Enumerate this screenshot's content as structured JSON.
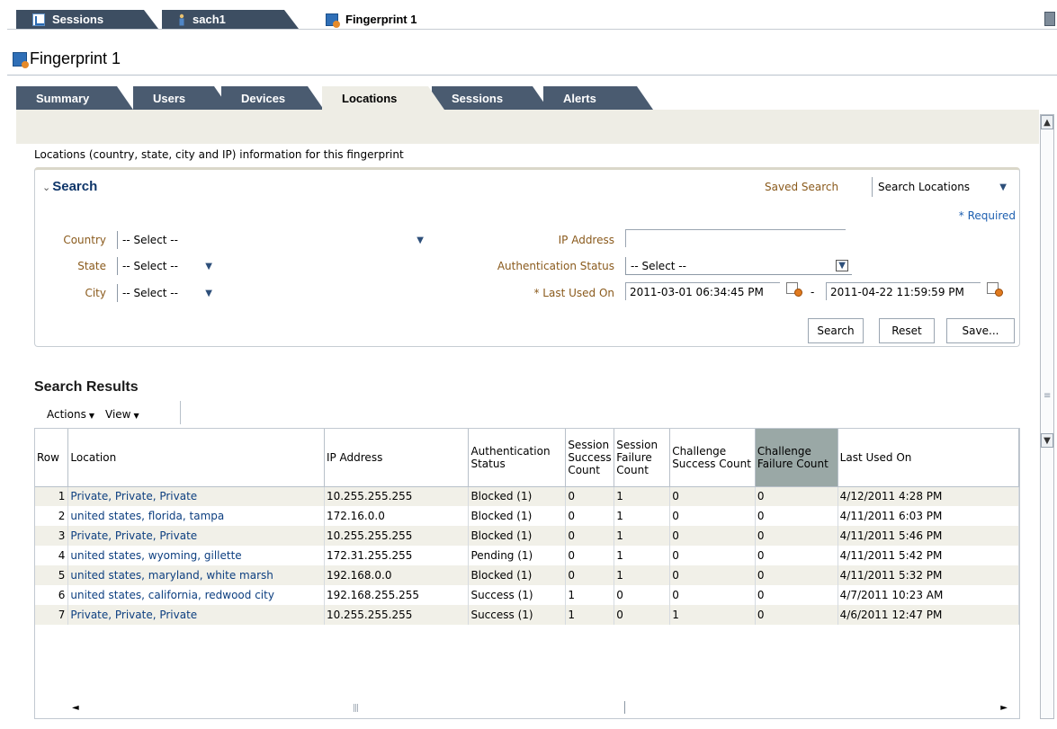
{
  "window_tabs": [
    {
      "label": "Sessions",
      "icon": "sessions-icon"
    },
    {
      "label": "sach1",
      "icon": "user-icon"
    },
    {
      "label": "Fingerprint 1",
      "icon": "fingerprint-icon"
    }
  ],
  "page": {
    "title": "Fingerprint 1"
  },
  "tabs": [
    {
      "label": "Summary"
    },
    {
      "label": "Users"
    },
    {
      "label": "Devices"
    },
    {
      "label": "Locations",
      "active": true
    },
    {
      "label": "Sessions"
    },
    {
      "label": "Alerts"
    }
  ],
  "description": "Locations (country, state, city and IP) information for this fingerprint",
  "search": {
    "header": "Search",
    "saved_search_label": "Saved Search",
    "saved_search_value": "Search Locations",
    "required_note": "* Required",
    "country_label": "Country",
    "country_value": "-- Select --",
    "state_label": "State",
    "state_value": "-- Select --",
    "city_label": "City",
    "city_value": "-- Select --",
    "ip_label": "IP Address",
    "ip_value": "",
    "auth_label": "Authentication Status",
    "auth_value": "-- Select --",
    "last_used_label": "* Last Used On",
    "date_from": "2011-03-01 06:34:45 PM",
    "date_sep": "-",
    "date_to": "2011-04-22 11:59:59 PM",
    "buttons": {
      "search": "Search",
      "reset": "Reset",
      "save": "Save..."
    }
  },
  "results": {
    "title": "Search Results",
    "actions_label": "Actions",
    "view_label": "View",
    "columns": [
      "Row",
      "Location",
      "IP Address",
      "Authentication Status",
      "Session Success Count",
      "Session Failure Count",
      "Challenge Success Count",
      "Challenge Failure Count",
      "Last Used On"
    ],
    "rows": [
      [
        "1",
        "Private, Private, Private",
        "10.255.255.255",
        "Blocked (1)",
        "0",
        "1",
        "0",
        "0",
        "4/12/2011 4:28 PM"
      ],
      [
        "2",
        "united states, florida, tampa",
        "172.16.0.0",
        "Blocked (1)",
        "0",
        "1",
        "0",
        "0",
        "4/11/2011 6:03 PM"
      ],
      [
        "3",
        "Private, Private, Private",
        "10.255.255.255",
        "Blocked (1)",
        "0",
        "1",
        "0",
        "0",
        "4/11/2011 5:46 PM"
      ],
      [
        "4",
        "united states, wyoming, gillette",
        "172.31.255.255",
        "Pending (1)",
        "0",
        "1",
        "0",
        "0",
        "4/11/2011 5:42 PM"
      ],
      [
        "5",
        "united states, maryland, white marsh",
        "192.168.0.0",
        "Blocked (1)",
        "0",
        "1",
        "0",
        "0",
        "4/11/2011 5:32 PM"
      ],
      [
        "6",
        "united states, california, redwood city",
        "192.168.255.255",
        "Success (1)",
        "1",
        "0",
        "0",
        "0",
        "4/7/2011 10:23 AM"
      ],
      [
        "7",
        "Private, Private, Private",
        "10.255.255.255",
        "Success (1)",
        "1",
        "0",
        "1",
        "0",
        "4/6/2011 12:47 PM"
      ]
    ]
  }
}
